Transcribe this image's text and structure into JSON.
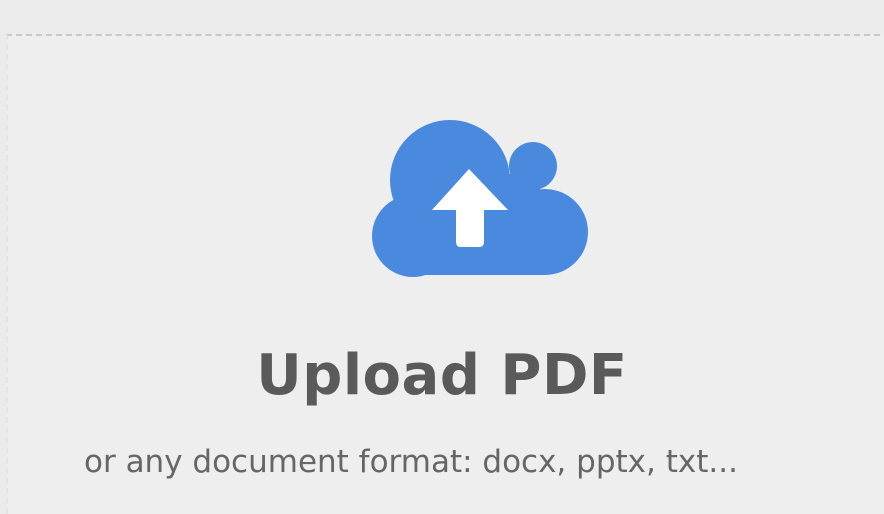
{
  "upload": {
    "title": "Upload PDF",
    "subtitle": "or any document format: docx, pptx, txt...",
    "icon": "cloud-upload-icon",
    "icon_color": "#4a8ade"
  }
}
